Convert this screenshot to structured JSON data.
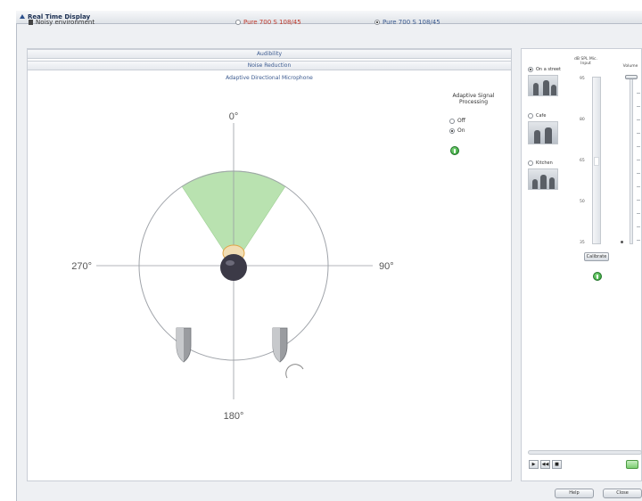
{
  "window": {
    "title": "Real Time Display"
  },
  "environment": {
    "label": "Noisy environment",
    "program_left": "Pure 700 S 108/45",
    "program_right": "Pure 700 S 108/45"
  },
  "sections": {
    "audibility": "Audibility",
    "noise_reduction": "Noise Reduction",
    "directional": "Adaptive Directional Microphone"
  },
  "polar": {
    "angle_top": "0°",
    "angle_right": "90°",
    "angle_bottom": "180°",
    "angle_left": "270°"
  },
  "signal_processing": {
    "title": "Adaptive Signal Processing",
    "off_label": "Off",
    "on_label": "On",
    "selected": "On",
    "indicator_icon": "info-green-icon"
  },
  "scenes": [
    {
      "label": "On a street",
      "selected": true
    },
    {
      "label": "Cafe",
      "selected": false
    },
    {
      "label": "Kitchen",
      "selected": false
    }
  ],
  "meters": {
    "input_header": "dB SPL Mic. Input",
    "volume_header": "Volume",
    "ticks": [
      "95",
      "80",
      "65",
      "50",
      "35"
    ],
    "calibrate_label": "Calibrate"
  },
  "playback": {
    "rewind": "◀◀",
    "stop": "■",
    "play": "▶"
  },
  "footer": {
    "help_label": "Help",
    "close_label": "Close"
  },
  "colors": {
    "beam": "#b9e2b0",
    "accent": "#3b5a8f",
    "program": "#c0392b"
  }
}
